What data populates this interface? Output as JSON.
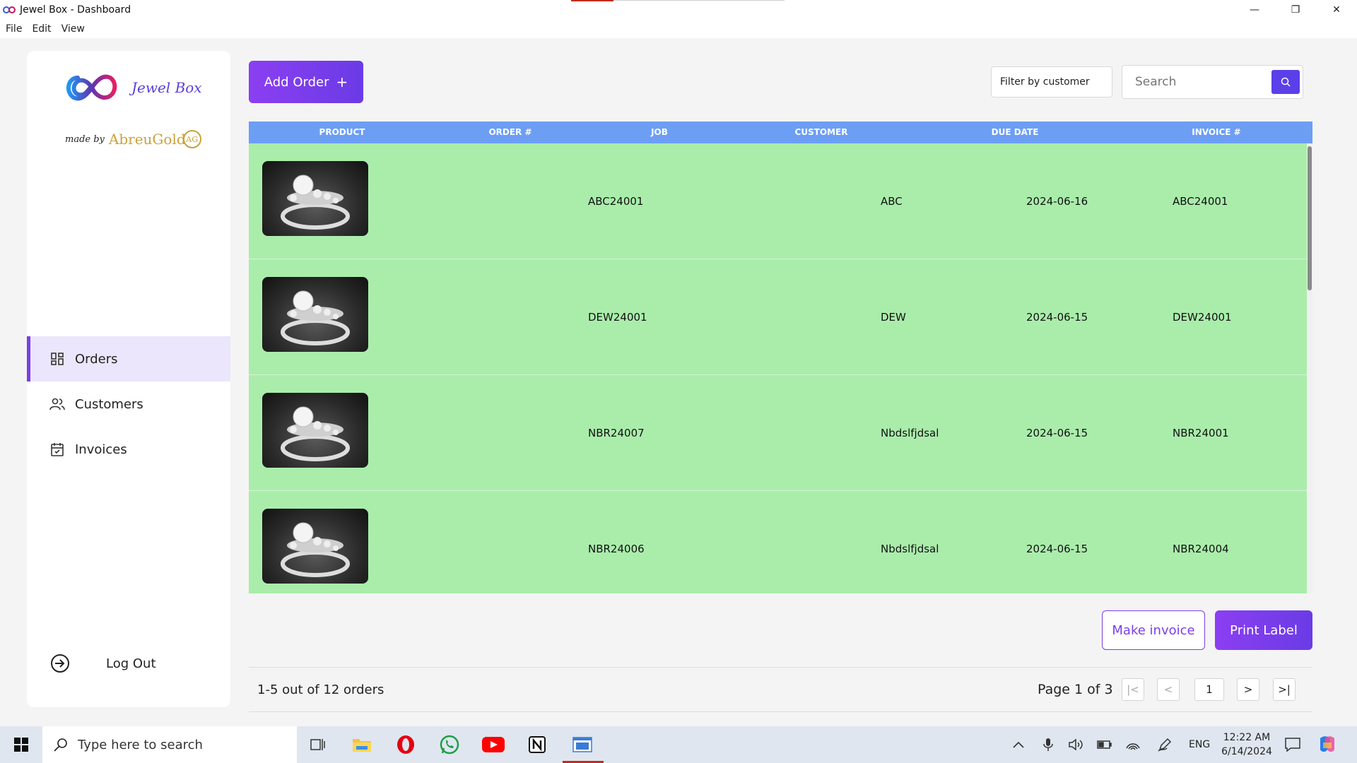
{
  "window": {
    "title": "Jewel Box - Dashboard",
    "minimize": "—",
    "restore": "❐",
    "close": "✕"
  },
  "menu": [
    "File",
    "Edit",
    "View"
  ],
  "sidebar": {
    "logo_text": "Jewel Box",
    "made_by_prefix": "made by",
    "made_by_brand": "AbreuGold",
    "made_by_mark": "AG",
    "items": [
      {
        "label": "Orders",
        "icon": "grid-icon",
        "active": true
      },
      {
        "label": "Customers",
        "icon": "users-icon",
        "active": false
      },
      {
        "label": "Invoices",
        "icon": "calendar-icon",
        "active": false
      }
    ],
    "logout_label": "Log Out"
  },
  "toolbar": {
    "add_order_label": "Add Order",
    "add_order_plus": "+",
    "filter_label": "Filter by customer",
    "search_placeholder": "Search"
  },
  "table": {
    "columns": [
      "PRODUCT",
      "ORDER #",
      "JOB",
      "CUSTOMER",
      "DUE DATE",
      "INVOICE #"
    ],
    "rows": [
      {
        "order": "ABC24001",
        "job": "",
        "customer": "ABC",
        "due": "2024-06-16",
        "invoice": "ABC24001"
      },
      {
        "order": "DEW24001",
        "job": "",
        "customer": "DEW",
        "due": "2024-06-15",
        "invoice": "DEW24001"
      },
      {
        "order": "NBR24007",
        "job": "",
        "customer": "Nbdslfjdsal",
        "due": "2024-06-15",
        "invoice": "NBR24001"
      },
      {
        "order": "NBR24006",
        "job": "",
        "customer": "Nbdslfjdsal",
        "due": "2024-06-15",
        "invoice": "NBR24004"
      }
    ]
  },
  "actions": {
    "make_invoice_label": "Make invoice",
    "print_label_label": "Print Label"
  },
  "pagination": {
    "summary": "1-5 out of 12 orders",
    "page_info": "Page 1 of 3",
    "first": "|<",
    "prev": "<",
    "current": "1",
    "next": ">",
    "last": ">|"
  },
  "taskbar": {
    "search_placeholder": "Type here to search",
    "language": "ENG",
    "time": "12:22 AM",
    "date": "6/14/2024"
  },
  "colors": {
    "accent": "#7b3fe4",
    "header_blue": "#6c9ef4",
    "row_green": "#aaedab"
  }
}
